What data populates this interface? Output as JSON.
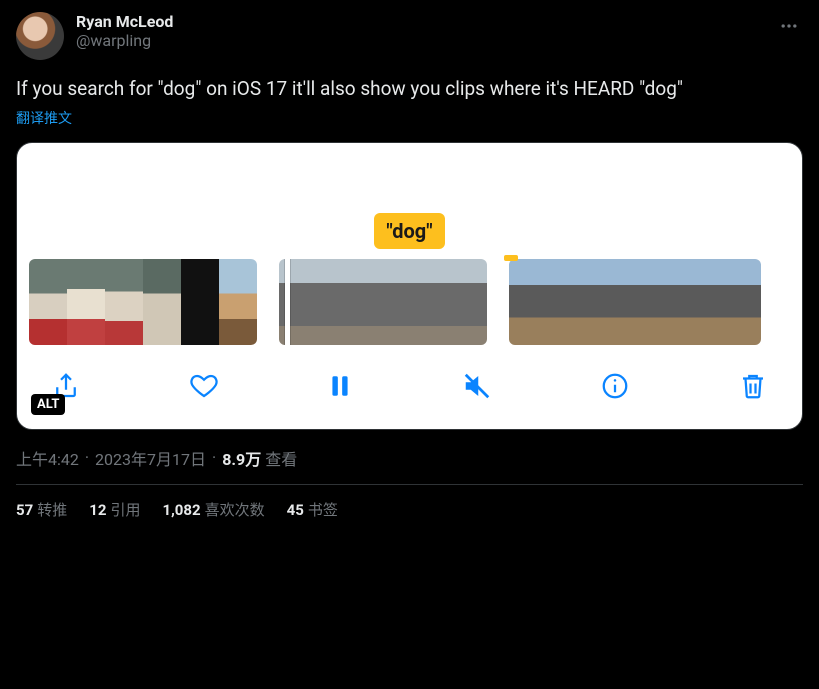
{
  "author": {
    "display_name": "Ryan McLeod",
    "handle": "@warpling"
  },
  "body": "If you search for \"dog\" on iOS 17 it'll also show you clips where it's HEARD \"dog\"",
  "translate_label": "翻译推文",
  "media": {
    "tag_text": "\"dog\"",
    "alt_badge": "ALT",
    "toolbar": {
      "share": "share-icon",
      "heart": "heart-icon",
      "pause": "pause-icon",
      "mute": "mute-icon",
      "info": "info-icon",
      "trash": "trash-icon"
    }
  },
  "meta": {
    "time": "上午4:42",
    "date": "2023年7月17日",
    "views_number": "8.9万",
    "views_label": "查看"
  },
  "stats": {
    "retweets": {
      "n": "57",
      "label": "转推"
    },
    "quotes": {
      "n": "12",
      "label": "引用"
    },
    "likes": {
      "n": "1,082",
      "label": "喜欢次数"
    },
    "bookmarks": {
      "n": "45",
      "label": "书签"
    }
  }
}
